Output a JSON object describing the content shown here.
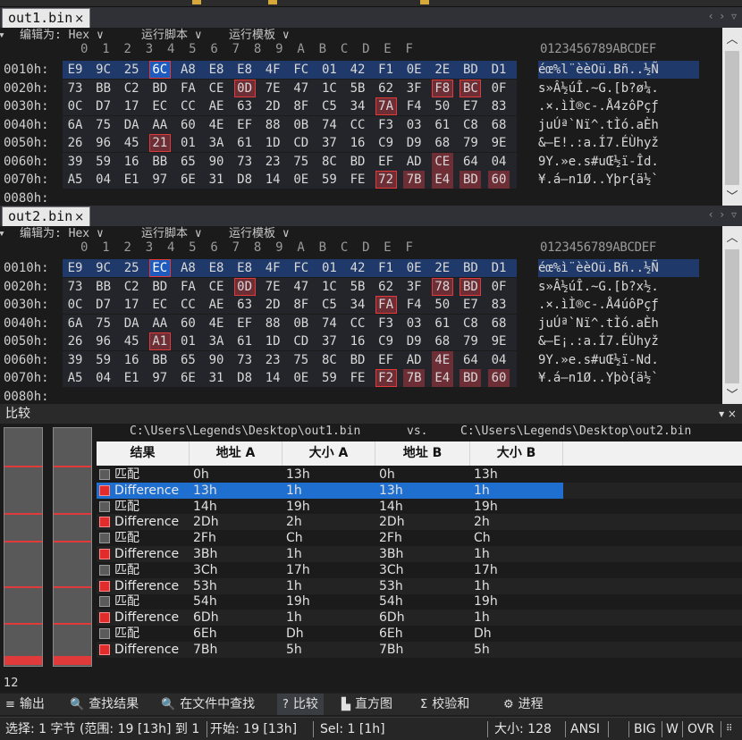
{
  "file_a": {
    "tab_label": "out1.bin",
    "close_glyph": "×",
    "toolbar": {
      "edit_as": "编辑为: Hex",
      "run_script": "运行脚本",
      "run_template": "运行模板"
    },
    "col_header": "0  1  2  3  4  5  6  7  8  9  A  B  C  D  E  F",
    "ascii_header": "0123456789ABCDEF",
    "rows": [
      {
        "addr": "0010h:",
        "bytes": [
          "E9",
          "9C",
          "25",
          "6C",
          "A8",
          "E8",
          "E8",
          "4F",
          "FC",
          "01",
          "42",
          "F1",
          "0E",
          "2E",
          "BD",
          "D1"
        ],
        "ascii": "éœ%l¨èèOü.Bñ..½Ñ",
        "sel": [
          3
        ],
        "diff": [],
        "box": [
          3
        ],
        "selected_row": true
      },
      {
        "addr": "0020h:",
        "bytes": [
          "73",
          "BB",
          "C2",
          "BD",
          "FA",
          "CE",
          "0D",
          "7E",
          "47",
          "1C",
          "5B",
          "62",
          "3F",
          "F8",
          "BC",
          "0F"
        ],
        "ascii": "s»Â½úÎ.~G.[b?ø¼.",
        "sel": [],
        "diff": [
          6,
          13,
          14
        ],
        "box": [
          6,
          13,
          14
        ]
      },
      {
        "addr": "0030h:",
        "bytes": [
          "0C",
          "D7",
          "17",
          "EC",
          "CC",
          "AE",
          "63",
          "2D",
          "8F",
          "C5",
          "34",
          "7A",
          "F4",
          "50",
          "E7",
          "83"
        ],
        "ascii": ".×.ìÌ®c-.Å4zôPçƒ",
        "sel": [],
        "diff": [
          11
        ],
        "box": [
          11
        ]
      },
      {
        "addr": "0040h:",
        "bytes": [
          "6A",
          "75",
          "DA",
          "AA",
          "60",
          "4E",
          "EF",
          "88",
          "0B",
          "74",
          "CC",
          "F3",
          "03",
          "61",
          "C8",
          "68"
        ],
        "ascii": "juÚª`Nï^.tÌó.aÈh",
        "sel": [],
        "diff": [],
        "box": []
      },
      {
        "addr": "0050h:",
        "bytes": [
          "26",
          "96",
          "45",
          "21",
          "01",
          "3A",
          "61",
          "1D",
          "CD",
          "37",
          "16",
          "C9",
          "D9",
          "68",
          "79",
          "9E"
        ],
        "ascii": "&–E!.:a.Í7.ÉÙhyž",
        "sel": [],
        "diff": [
          3
        ],
        "box": [
          3
        ]
      },
      {
        "addr": "0060h:",
        "bytes": [
          "39",
          "59",
          "16",
          "BB",
          "65",
          "90",
          "73",
          "23",
          "75",
          "8C",
          "BD",
          "EF",
          "AD",
          "CE",
          "64",
          "04"
        ],
        "ascii": "9Y.»e.s#uŒ½ï-Îd.",
        "sel": [],
        "diff": [
          13
        ],
        "box": []
      },
      {
        "addr": "0070h:",
        "bytes": [
          "A5",
          "04",
          "E1",
          "97",
          "6E",
          "31",
          "D8",
          "14",
          "0E",
          "59",
          "FE",
          "72",
          "7B",
          "E4",
          "BD",
          "60"
        ],
        "ascii": "¥.á—n1Ø..Yþr{ä½`",
        "sel": [],
        "diff": [
          11,
          12,
          13,
          14,
          15
        ],
        "box": [
          11
        ]
      }
    ],
    "partial_addr": "0080h:"
  },
  "file_b": {
    "tab_label": "out2.bin",
    "close_glyph": "×",
    "toolbar": {
      "edit_as": "编辑为: Hex",
      "run_script": "运行脚本",
      "run_template": "运行模板"
    },
    "col_header": "0  1  2  3  4  5  6  7  8  9  A  B  C  D  E  F",
    "ascii_header": "0123456789ABCDEF",
    "rows": [
      {
        "addr": "0010h:",
        "bytes": [
          "E9",
          "9C",
          "25",
          "EC",
          "A8",
          "E8",
          "E8",
          "4F",
          "FC",
          "01",
          "42",
          "F1",
          "0E",
          "2E",
          "BD",
          "D1"
        ],
        "ascii": "éœ%ì¨èèOü.Bñ..½Ñ",
        "sel": [
          3
        ],
        "diff": [],
        "box": [
          3
        ],
        "selected_row": true
      },
      {
        "addr": "0020h:",
        "bytes": [
          "73",
          "BB",
          "C2",
          "BD",
          "FA",
          "CE",
          "0D",
          "7E",
          "47",
          "1C",
          "5B",
          "62",
          "3F",
          "78",
          "BD",
          "0F"
        ],
        "ascii": "s»Â½úÎ.~G.[b?x½.",
        "sel": [],
        "diff": [
          6,
          13,
          14
        ],
        "box": [
          6,
          13,
          14
        ]
      },
      {
        "addr": "0030h:",
        "bytes": [
          "0C",
          "D7",
          "17",
          "EC",
          "CC",
          "AE",
          "63",
          "2D",
          "8F",
          "C5",
          "34",
          "FA",
          "F4",
          "50",
          "E7",
          "83"
        ],
        "ascii": ".×.ìÌ®c-.Å4úôPçƒ",
        "sel": [],
        "diff": [
          11
        ],
        "box": [
          11
        ]
      },
      {
        "addr": "0040h:",
        "bytes": [
          "6A",
          "75",
          "DA",
          "AA",
          "60",
          "4E",
          "EF",
          "88",
          "0B",
          "74",
          "CC",
          "F3",
          "03",
          "61",
          "C8",
          "68"
        ],
        "ascii": "juÚª`Nï^.tÌó.aÈh",
        "sel": [],
        "diff": [],
        "box": []
      },
      {
        "addr": "0050h:",
        "bytes": [
          "26",
          "96",
          "45",
          "A1",
          "01",
          "3A",
          "61",
          "1D",
          "CD",
          "37",
          "16",
          "C9",
          "D9",
          "68",
          "79",
          "9E"
        ],
        "ascii": "&–E¡.:a.Í7.ÉÙhyž",
        "sel": [],
        "diff": [
          3
        ],
        "box": [
          3
        ]
      },
      {
        "addr": "0060h:",
        "bytes": [
          "39",
          "59",
          "16",
          "BB",
          "65",
          "90",
          "73",
          "23",
          "75",
          "8C",
          "BD",
          "EF",
          "AD",
          "4E",
          "64",
          "04"
        ],
        "ascii": "9Y.»e.s#uŒ½ï-Nd.",
        "sel": [],
        "diff": [
          13
        ],
        "box": []
      },
      {
        "addr": "0070h:",
        "bytes": [
          "A5",
          "04",
          "E1",
          "97",
          "6E",
          "31",
          "D8",
          "14",
          "0E",
          "59",
          "FE",
          "F2",
          "7B",
          "E4",
          "BD",
          "60"
        ],
        "ascii": "¥.á—n1Ø..Yþò{ä½`",
        "sel": [],
        "diff": [
          11,
          12,
          13,
          14,
          15
        ],
        "box": [
          11
        ]
      }
    ],
    "partial_addr": "0080h:"
  },
  "compare": {
    "title": "比较",
    "controls": "▾ ×",
    "path_a": "C:\\Users\\Legends\\Desktop\\out1.bin",
    "vs": "vs.",
    "path_b": "C:\\Users\\Legends\\Desktop\\out2.bin",
    "columns": [
      "结果",
      "地址 A",
      "大小 A",
      "地址 B",
      "大小 B"
    ],
    "rows": [
      {
        "result": "匹配",
        "addr_a": "0h",
        "size_a": "13h",
        "addr_b": "0h",
        "size_b": "13h",
        "diff": false
      },
      {
        "result": "Difference",
        "addr_a": "13h",
        "size_a": "1h",
        "addr_b": "13h",
        "size_b": "1h",
        "diff": true,
        "selected": true
      },
      {
        "result": "匹配",
        "addr_a": "14h",
        "size_a": "19h",
        "addr_b": "14h",
        "size_b": "19h",
        "diff": false
      },
      {
        "result": "Difference",
        "addr_a": "2Dh",
        "size_a": "2h",
        "addr_b": "2Dh",
        "size_b": "2h",
        "diff": true
      },
      {
        "result": "匹配",
        "addr_a": "2Fh",
        "size_a": "Ch",
        "addr_b": "2Fh",
        "size_b": "Ch",
        "diff": false
      },
      {
        "result": "Difference",
        "addr_a": "3Bh",
        "size_a": "1h",
        "addr_b": "3Bh",
        "size_b": "1h",
        "diff": true
      },
      {
        "result": "匹配",
        "addr_a": "3Ch",
        "size_a": "17h",
        "addr_b": "3Ch",
        "size_b": "17h",
        "diff": false
      },
      {
        "result": "Difference",
        "addr_a": "53h",
        "size_a": "1h",
        "addr_b": "53h",
        "size_b": "1h",
        "diff": true
      },
      {
        "result": "匹配",
        "addr_a": "54h",
        "size_a": "19h",
        "addr_b": "54h",
        "size_b": "19h",
        "diff": false
      },
      {
        "result": "Difference",
        "addr_a": "6Dh",
        "size_a": "1h",
        "addr_b": "6Dh",
        "size_b": "1h",
        "diff": true
      },
      {
        "result": "匹配",
        "addr_a": "6Eh",
        "size_a": "Dh",
        "addr_b": "6Eh",
        "size_b": "Dh",
        "diff": false
      },
      {
        "result": "Difference",
        "addr_a": "7Bh",
        "size_a": "5h",
        "addr_b": "7Bh",
        "size_b": "5h",
        "diff": true
      }
    ],
    "count": "12"
  },
  "bottom_tabs": [
    {
      "label": "输出",
      "icon": "≡"
    },
    {
      "label": "查找结果",
      "icon": "🔍"
    },
    {
      "label": "在文件中查找",
      "icon": "🔍"
    },
    {
      "label": "比较",
      "icon": "?",
      "active": true
    },
    {
      "label": "直方图",
      "icon": "▙"
    },
    {
      "label": "校验和",
      "icon": "Σ"
    },
    {
      "label": "进程",
      "icon": "⚙"
    }
  ],
  "status": {
    "selection": "选择: 1 字节 (范围: 19 [13h] 到 1",
    "start": "开始: 19 [13h]",
    "sel": "Sel: 1 [1h]",
    "size": "大小: 128",
    "encoding": "ANSI",
    "endian": "BIG",
    "w": "W",
    "ovr": "OVR"
  },
  "colors": {
    "diff_bg": "#6d2e35",
    "selection": "#1f5bbd",
    "diff_marker": "#e22b2b"
  }
}
